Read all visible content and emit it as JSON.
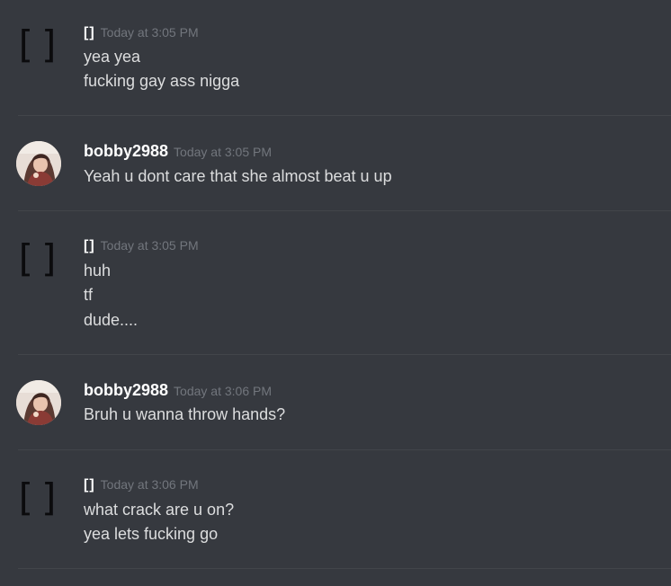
{
  "messages": [
    {
      "user": "[]",
      "avatar": "bracket",
      "timestamp": "Today at 3:05 PM",
      "lines": [
        "yea yea",
        "fucking gay ass nigga"
      ]
    },
    {
      "user": "bobby2988",
      "avatar": "photo",
      "timestamp": "Today at 3:05 PM",
      "lines": [
        "Yeah u dont care that she almost beat u up"
      ]
    },
    {
      "user": "[]",
      "avatar": "bracket",
      "timestamp": "Today at 3:05 PM",
      "lines": [
        "huh",
        "tf",
        "dude...."
      ]
    },
    {
      "user": "bobby2988",
      "avatar": "photo",
      "timestamp": "Today at 3:06 PM",
      "lines": [
        "Bruh u wanna throw hands?"
      ]
    },
    {
      "user": "[]",
      "avatar": "bracket",
      "timestamp": "Today at 3:06 PM",
      "lines": [
        "what crack are u on?",
        "yea lets fucking go"
      ]
    }
  ],
  "colors": {
    "background": "#36393f",
    "divider": "#42454a",
    "username": "#ffffff",
    "timestamp": "#72767d",
    "message_text": "#dcddde"
  }
}
